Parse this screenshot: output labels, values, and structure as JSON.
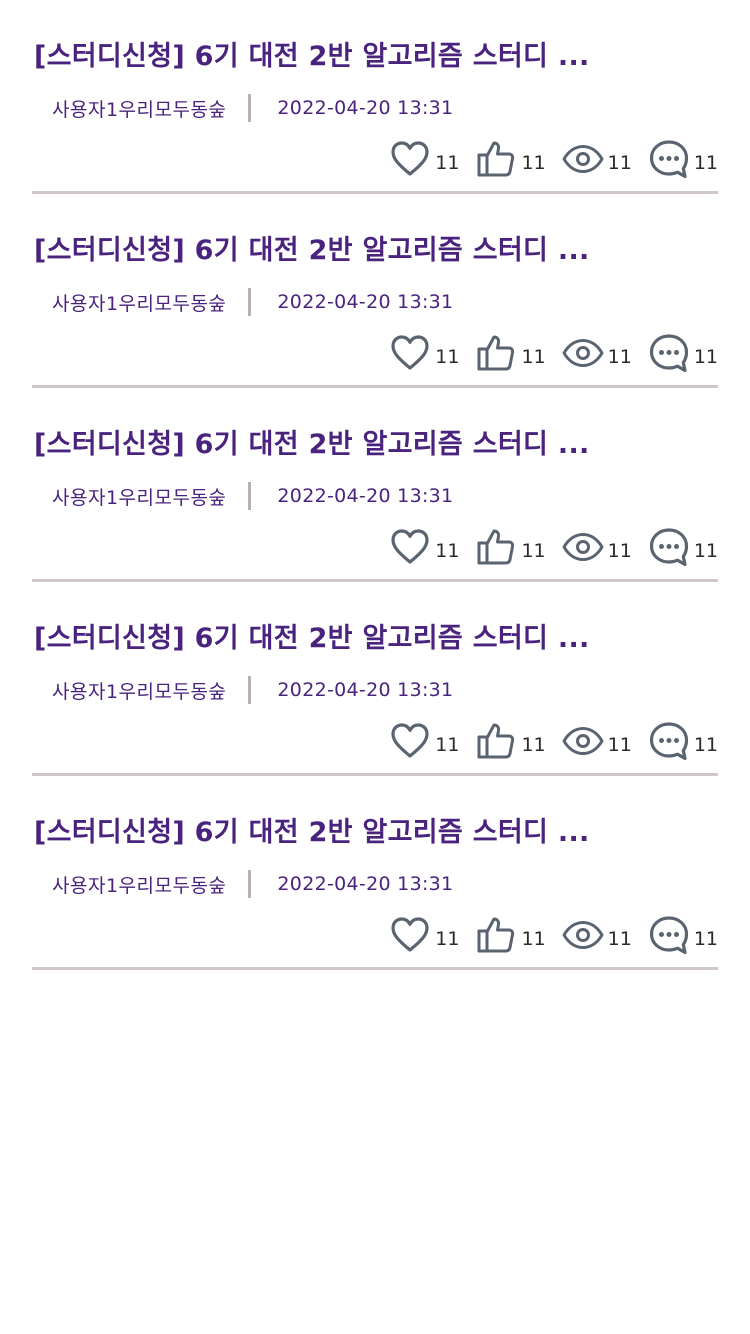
{
  "posts": [
    {
      "title": "[스터디신청] 6기 대전 2반 알고리즘 스터디 ...",
      "author": "사용자1우리모두동숲",
      "date": "2022-04-20 13:31",
      "likes": "11",
      "thumbs": "11",
      "views": "11",
      "comments": "11"
    },
    {
      "title": "[스터디신청] 6기 대전 2반 알고리즘 스터디 ...",
      "author": "사용자1우리모두동숲",
      "date": "2022-04-20 13:31",
      "likes": "11",
      "thumbs": "11",
      "views": "11",
      "comments": "11"
    },
    {
      "title": "[스터디신청] 6기 대전 2반 알고리즘 스터디 ...",
      "author": "사용자1우리모두동숲",
      "date": "2022-04-20 13:31",
      "likes": "11",
      "thumbs": "11",
      "views": "11",
      "comments": "11"
    },
    {
      "title": "[스터디신청] 6기 대전 2반 알고리즘 스터디 ...",
      "author": "사용자1우리모두동숲",
      "date": "2022-04-20 13:31",
      "likes": "11",
      "thumbs": "11",
      "views": "11",
      "comments": "11"
    },
    {
      "title": "[스터디신청] 6기 대전 2반 알고리즘 스터디 ...",
      "author": "사용자1우리모두동숲",
      "date": "2022-04-20 13:31",
      "likes": "11",
      "thumbs": "11",
      "views": "11",
      "comments": "11"
    }
  ],
  "colors": {
    "title": "#4a237e",
    "icon": "#5a6470",
    "divider": "#cfc7cc"
  },
  "icons": {
    "like": "heart-icon",
    "thumb": "thumbs-up-icon",
    "view": "eye-icon",
    "comment": "chat-bubble-icon"
  }
}
